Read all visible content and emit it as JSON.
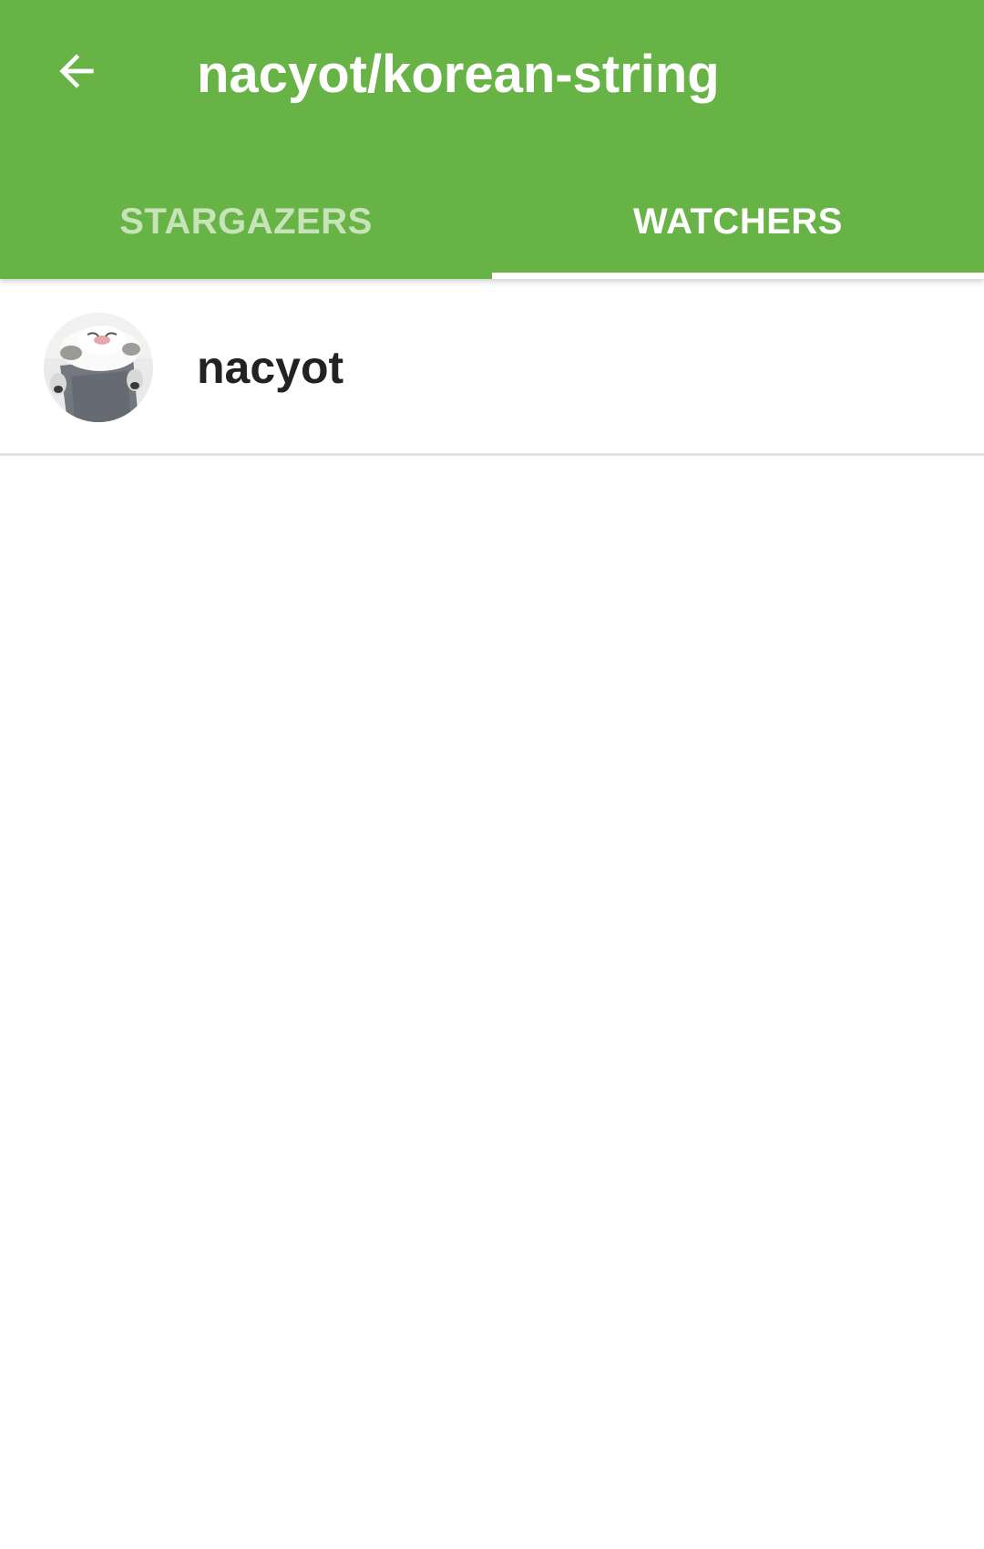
{
  "theme": {
    "primary": "#67b346",
    "tab_inactive": "#c7e4b8",
    "text_primary": "#222222",
    "divider": "#e2e2e2"
  },
  "toolbar": {
    "back_icon": "arrow-back-icon",
    "title": "nacyot/korean-string"
  },
  "tabs": [
    {
      "label": "STARGAZERS",
      "selected": false
    },
    {
      "label": "WATCHERS",
      "selected": true
    }
  ],
  "watchers": [
    {
      "username": "nacyot",
      "avatar": "cat-photo-avatar"
    }
  ]
}
